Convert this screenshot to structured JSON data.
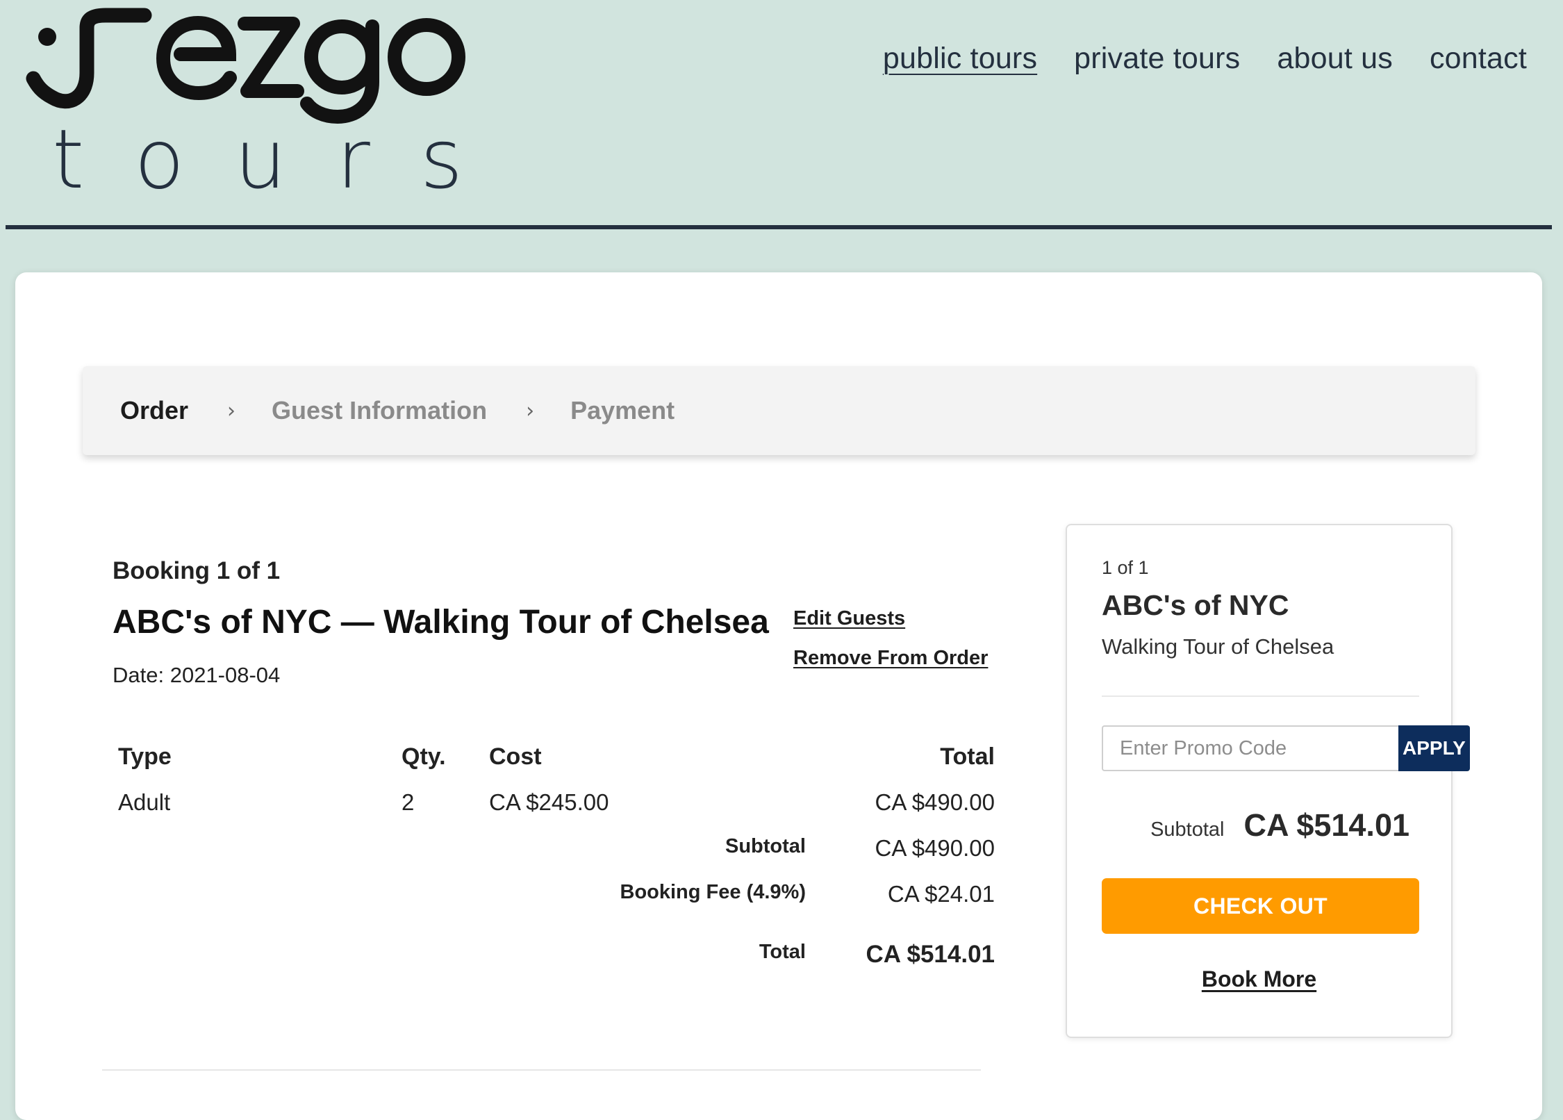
{
  "brand": {
    "logo_text": "rezgo",
    "wordmark": "tours",
    "logo_color": "#121212",
    "wordmark_color": "#24303f"
  },
  "nav": {
    "items": [
      {
        "label": "public tours",
        "active": true
      },
      {
        "label": "private tours",
        "active": false
      },
      {
        "label": "about us",
        "active": false
      },
      {
        "label": "contact",
        "active": false
      }
    ]
  },
  "steps": {
    "items": [
      {
        "label": "Order",
        "current": true
      },
      {
        "label": "Guest Information",
        "current": false
      },
      {
        "label": "Payment",
        "current": false
      }
    ],
    "separator": "›"
  },
  "booking": {
    "count_label": "Booking 1 of 1",
    "title": "ABC's of NYC — Walking Tour of Chelsea",
    "date": "Date: 2021-08-04",
    "edit_guests_label": "Edit Guests",
    "remove_label": "Remove From Order",
    "table": {
      "headers": {
        "type": "Type",
        "qty": "Qty.",
        "cost": "Cost",
        "total": "Total"
      },
      "rows": [
        {
          "type": "Adult",
          "qty": "2",
          "cost": "CA $245.00",
          "total": "CA $490.00"
        }
      ],
      "subtotal_label": "Subtotal",
      "subtotal_value": "CA $490.00",
      "fee_label": "Booking Fee (4.9%)",
      "fee_value": "CA $24.01",
      "total_label": "Total",
      "total_value": "CA $514.01"
    }
  },
  "summary": {
    "count_label": "1 of 1",
    "title": "ABC's of NYC",
    "subtitle": "Walking Tour of Chelsea",
    "promo_placeholder": "Enter Promo Code",
    "promo_value": "",
    "apply_label": "APPLY",
    "subtotal_label": "Subtotal",
    "subtotal_value": "CA $514.01",
    "checkout_label": "CHECK OUT",
    "book_more_label": "Book More"
  },
  "colors": {
    "page_bg": "#d1e4de",
    "header_rule": "#24303f",
    "apply_button": "#0d2d5c",
    "checkout_button": "#ff9b00"
  }
}
